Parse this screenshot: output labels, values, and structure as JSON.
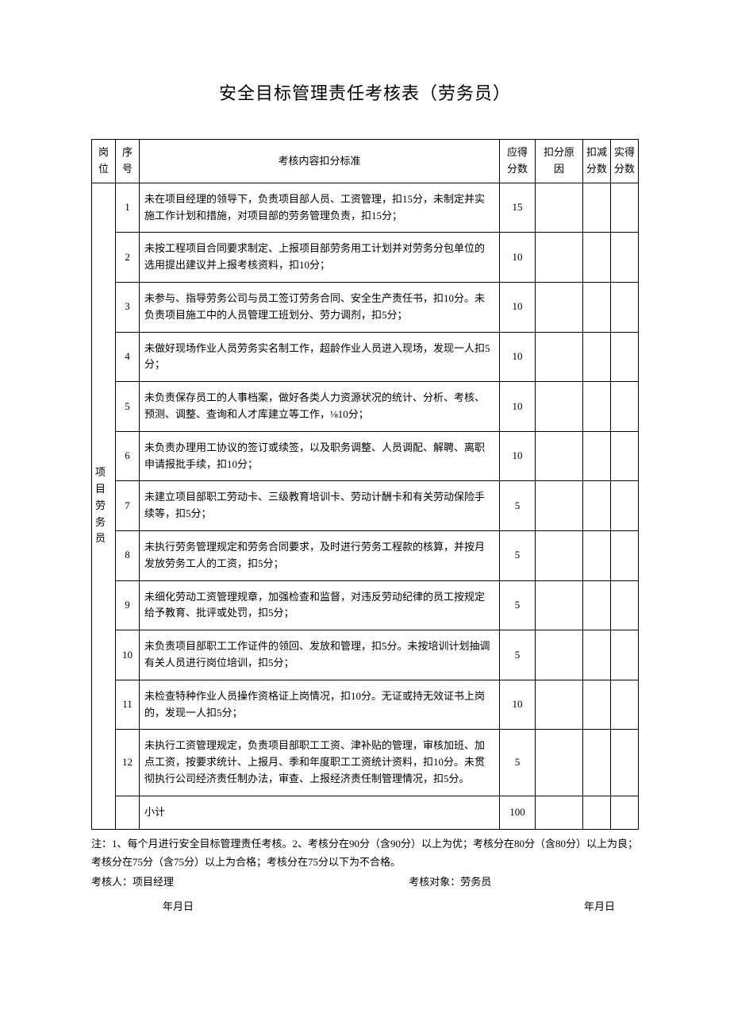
{
  "title": "安全目标管理责任考核表（劳务员）",
  "headers": {
    "post": "岗位",
    "seq": "序号",
    "content": "考核内容扣分标准",
    "score": "应得分数",
    "reason": "扣分原因",
    "deduct": "扣减分数",
    "actual": "实得分数"
  },
  "post_label": "项目劳务员",
  "rows": [
    {
      "seq": "1",
      "content": "未在项目经理的领导下，负责项目部人员、工资管理，扣15分，未制定并实施工作计划和措施，对项目部的劳务管理负责，扣15分；",
      "score": "15"
    },
    {
      "seq": "2",
      "content": "未按工程项目合同要求制定、上报项目部劳务用工计划并对劳务分包单位的选用提出建议并上报考核资料，扣10分；",
      "score": "10"
    },
    {
      "seq": "3",
      "content": "未参与、指导劳务公司与员工签订劳务合同、安全生产责任书，扣10分。未负责项目施工中的人员管理工班划分、劳力调剂，扣5分；",
      "score": "10"
    },
    {
      "seq": "4",
      "content": "未做好现场作业人员劳务实名制工作，超龄作业人员进入现场，发现一人扣5分；",
      "score": "10"
    },
    {
      "seq": "5",
      "content": "未负责保存员工的人事档案，做好各类人力资源状况的统计、分析、考核、预测、调整、查询和人才库建立等工作，⅛10分；",
      "score": "10"
    },
    {
      "seq": "6",
      "content": "未负责办理用工协议的签订或续签，以及职务调整、人员调配、解聘、离职申请报批手续，扣10分；",
      "score": "10"
    },
    {
      "seq": "7",
      "content": "未建立项目部职工劳动卡、三级教育培训卡、劳动计酬卡和有关劳动保险手续等，扣5分；",
      "score": "5"
    },
    {
      "seq": "8",
      "content": "未执行劳务管理规定和劳务合同要求，及时进行劳务工程款的核算，并按月发放劳务工人的工资，扣5分；",
      "score": "5"
    },
    {
      "seq": "9",
      "content": "未细化劳动工资管理规章，加强检查和监督，对违反劳动纪律的员工按规定给予教育、批评或处罚，扣5分；",
      "score": "5"
    },
    {
      "seq": "10",
      "content": "未负责项目部职工工作证件的领回、发放和管理，扣5分。未按培训计划抽调有关人员进行岗位培训，扣5分；",
      "score": "5"
    },
    {
      "seq": "11",
      "content": "未检查特种作业人员操作资格证上岗情况，扣10分。无证或持无效证书上岗的，发现一人扣5分；",
      "score": "10"
    },
    {
      "seq": "12",
      "content": "未执行工资管理规定，负责项目部职工工资、津补贴的管理，审核加班、加点工资，按要求统计、上报月、季和年度职工工资统计资料，扣10分。未贯彻执行公司经济责任制办法，审查、上报经济责任制管理情况，扣5分。",
      "score": "5"
    }
  ],
  "subtotal": {
    "label": "小计",
    "score": "100"
  },
  "notes": "注：1、每个月进行安全目标管理责任考核。2、考核分在90分（含90分）以上为优；考核分在80分（含80分）以上为良；考核分在75分（含75分）以上为合格；考核分在75分以下为不合格。",
  "assessor_label": "考核人：项目经理",
  "target_label": "考核对象：劳务员",
  "date_text": "年月日"
}
